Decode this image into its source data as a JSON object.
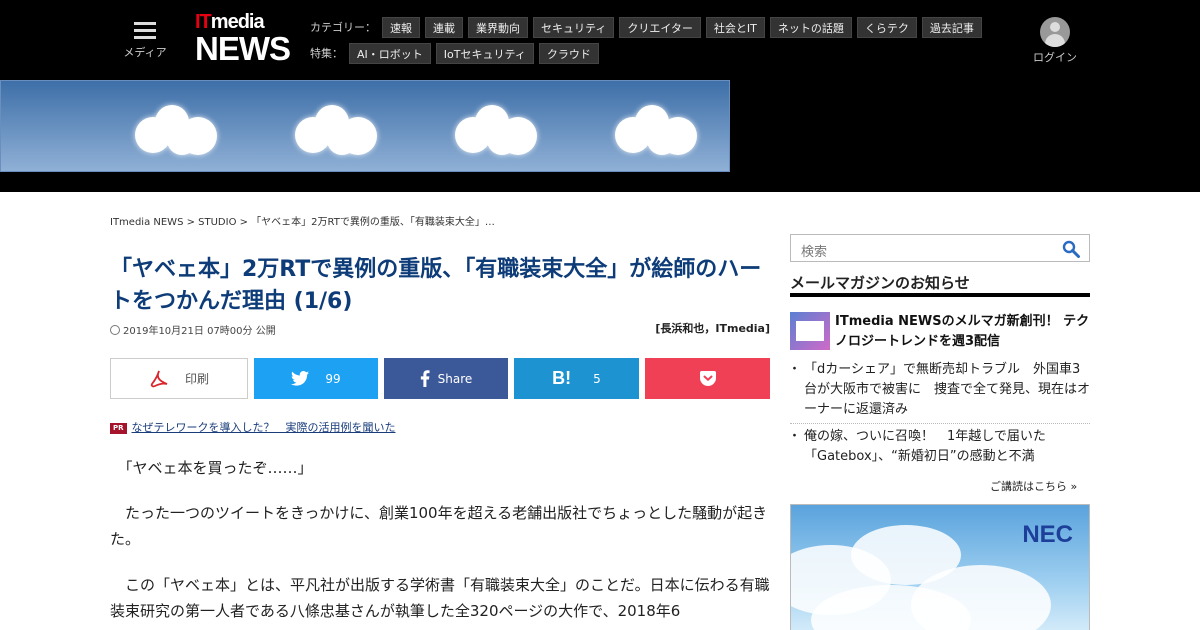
{
  "header": {
    "menu_label": "メディア",
    "logo_it": "IT",
    "logo_media": "media",
    "logo_news": "NEWS",
    "category_label": "カテゴリー：",
    "categories": [
      "速報",
      "連載",
      "業界動向",
      "セキュリティ",
      "クリエイター",
      "社会とIT",
      "ネットの話題",
      "くらテク",
      "過去記事"
    ],
    "feature_label": "特集：",
    "features": [
      "AI・ロボット",
      "IoTセキュリティ",
      "クラウド"
    ],
    "login_label": "ログイン"
  },
  "breadcrumb": "ITmedia NEWS > STUDIO > 「ヤベェ本」2万RTで異例の重版、「有職装束大全」…",
  "article": {
    "title": "「ヤベェ本」2万RTで異例の重版、「有職装束大全」が絵師のハートをつかんだ理由 (1/6)",
    "date": "2019年10月21日 07時00分 公開",
    "author": "[長浜和也，ITmedia]",
    "p1": "「ヤベェ本を買ったぞ……」",
    "p2": "たった一つのツイートをきっかけに、創業100年を超える老舗出版社でちょっとした騒動が起きた。",
    "p3": "この「ヤベェ本」とは、平凡社が出版する学術書「有職装束大全」のことだ。日本に伝わる有職装束研究の第一人者である八條忠基さんが執筆した全320ページの大作で、2018年6"
  },
  "share": {
    "print_label": "印刷",
    "twitter_count": "99",
    "facebook_label": "Share",
    "hatena_count": "5"
  },
  "pr": {
    "badge": "PR",
    "link": "なぜテレワークを導入した？　実際の活用例を聞いた"
  },
  "sidebar": {
    "search_placeholder": "検索",
    "mailmag_heading": "メールマガジンのお知らせ",
    "mailmag_title": "ITmedia NEWSのメルマガ新創刊！ テクノロジートレンドを週3配信",
    "news": [
      "「dカーシェア」で無断売却トラブル　外国車3台が大阪市で被害に　捜査で全て発見、現在はオーナーに返還済み",
      "俺の嫁、ついに召喚！　1年越しで届いた「Gatebox」、“新婚初日”の感動と不満"
    ],
    "subscribe": "ご講読はこちら »",
    "ad_brand": "NEC"
  },
  "colors": {
    "title": "#0d3c78",
    "twitter": "#1da1f2",
    "facebook": "#3b5998",
    "hatena": "#1d93d2",
    "pocket": "#ef4056",
    "logo_red": "#e60012"
  }
}
